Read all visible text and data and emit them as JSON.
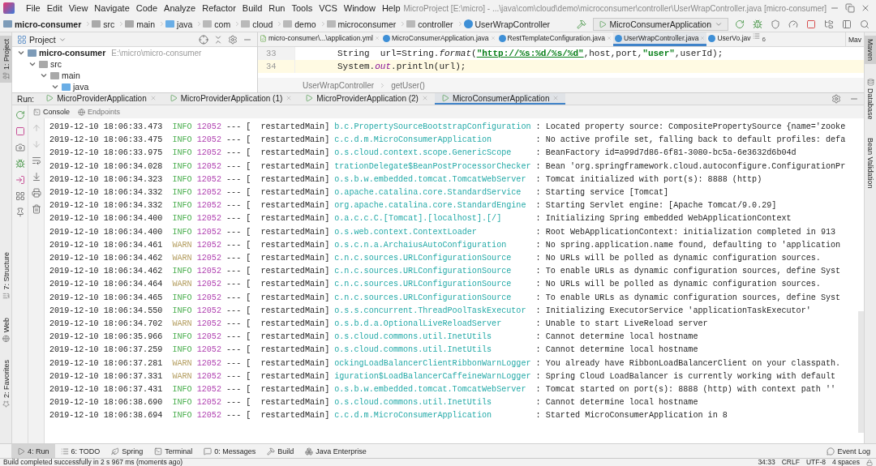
{
  "window": {
    "title": "MicroProject [E:\\micro] - ...\\java\\com\\cloud\\demo\\microconsumer\\controller\\UserWrapController.java [micro-consumer]"
  },
  "menu": [
    "File",
    "Edit",
    "View",
    "Navigate",
    "Code",
    "Analyze",
    "Refactor",
    "Build",
    "Run",
    "Tools",
    "VCS",
    "Window",
    "Help"
  ],
  "breadcrumb": [
    {
      "label": "micro-consumer",
      "kind": "module"
    },
    {
      "label": "src",
      "kind": "folder"
    },
    {
      "label": "main",
      "kind": "folder"
    },
    {
      "label": "java",
      "kind": "source"
    },
    {
      "label": "com",
      "kind": "package"
    },
    {
      "label": "cloud",
      "kind": "package"
    },
    {
      "label": "demo",
      "kind": "package"
    },
    {
      "label": "microconsumer",
      "kind": "package"
    },
    {
      "label": "controller",
      "kind": "package"
    },
    {
      "label": "UserWrapController",
      "kind": "class"
    }
  ],
  "run_config": {
    "label": "MicroConsumerApplication"
  },
  "left_stripe": {
    "top": [
      {
        "label": "1: Project",
        "selected": true
      }
    ],
    "bottom": [
      {
        "label": "7: Structure",
        "selected": false
      },
      {
        "label": "Web",
        "selected": false
      },
      {
        "label": "2: Favorites",
        "selected": false
      }
    ]
  },
  "right_stripe": [
    {
      "label": "Maven",
      "selected": true
    },
    {
      "label": "Database",
      "selected": false
    },
    {
      "label": "Bean Validation",
      "selected": false
    }
  ],
  "project": {
    "title": "Project",
    "tree": [
      {
        "label": "micro-consumer",
        "path": "E:\\micro\\micro-consumer",
        "kind": "module",
        "expanded": true,
        "children": [
          {
            "label": "src",
            "kind": "folder",
            "expanded": true,
            "children": [
              {
                "label": "main",
                "kind": "folder",
                "expanded": true,
                "children": [
                  {
                    "label": "java",
                    "kind": "source",
                    "expanded": true
                  }
                ]
              }
            ]
          }
        ]
      }
    ]
  },
  "editor": {
    "tabs": [
      {
        "label": "micro-consumer\\...\\application.yml",
        "kind": "yaml",
        "selected": false
      },
      {
        "label": "MicroConsumerApplication.java",
        "kind": "class",
        "selected": false
      },
      {
        "label": "RestTemplateConfiguration.java",
        "kind": "class",
        "selected": false
      },
      {
        "label": "UserWrapController.java",
        "kind": "class",
        "selected": true
      },
      {
        "label": "UserVo.jav",
        "kind": "class",
        "selected": false
      }
    ],
    "hidden_tabs": "6",
    "side_panel_label": "Mav",
    "lines": [
      {
        "number": "33",
        "current": false,
        "tokens": [
          {
            "text": "String  url=String.",
            "kind": "plain"
          },
          {
            "text": "format",
            "kind": "static"
          },
          {
            "text": "(",
            "kind": "plain"
          },
          {
            "text": "\"http://%s:%d/%s/%d\"",
            "kind": "url"
          },
          {
            "text": ",host,port,",
            "kind": "plain"
          },
          {
            "text": "\"user\"",
            "kind": "string"
          },
          {
            "text": ",userId);",
            "kind": "plain"
          }
        ]
      },
      {
        "number": "34",
        "current": true,
        "tokens": [
          {
            "text": "System.",
            "kind": "plain"
          },
          {
            "text": "out",
            "kind": "field"
          },
          {
            "text": ".println(url);",
            "kind": "plain"
          }
        ]
      }
    ],
    "breadcrumb": [
      "UserWrapController",
      "getUser()"
    ]
  },
  "run": {
    "label": "Run:",
    "tabs": [
      {
        "label": "MicroProviderApplication",
        "selected": false
      },
      {
        "label": "MicroProviderApplication (1)",
        "selected": false
      },
      {
        "label": "MicroProviderApplication (2)",
        "selected": false
      },
      {
        "label": "MicroConsumerApplication",
        "selected": true
      }
    ],
    "console_tabs": [
      {
        "label": "Console",
        "selected": true
      },
      {
        "label": "Endpoints",
        "selected": false
      }
    ],
    "log": [
      {
        "time": "2019-12-10 18:06:33.473",
        "severity": "INFO",
        "pid": "12052",
        "thread": "--- [  restartedMain]",
        "logger": "b.c.PropertySourceBootstrapConfiguration",
        "message": ": Located property source: CompositePropertySource {name='zooke"
      },
      {
        "time": "2019-12-10 18:06:33.475",
        "severity": "INFO",
        "pid": "12052",
        "thread": "--- [  restartedMain]",
        "logger": "c.c.d.m.MicroConsumerApplication",
        "message": ": No active profile set, falling back to default profiles: defa"
      },
      {
        "time": "2019-12-10 18:06:33.975",
        "severity": "INFO",
        "pid": "12052",
        "thread": "--- [  restartedMain]",
        "logger": "o.s.cloud.context.scope.GenericScope",
        "message": ": BeanFactory id=a99d7d86-6f81-3080-bc5a-6e3632d6b04d"
      },
      {
        "time": "2019-12-10 18:06:34.028",
        "severity": "INFO",
        "pid": "12052",
        "thread": "--- [  restartedMain]",
        "logger": "trationDelegate$BeanPostProcessorChecker",
        "message": ": Bean 'org.springframework.cloud.autoconfigure.ConfigurationPr"
      },
      {
        "time": "2019-12-10 18:06:34.323",
        "severity": "INFO",
        "pid": "12052",
        "thread": "--- [  restartedMain]",
        "logger": "o.s.b.w.embedded.tomcat.TomcatWebServer",
        "message": ": Tomcat initialized with port(s): 8888 (http)"
      },
      {
        "time": "2019-12-10 18:06:34.332",
        "severity": "INFO",
        "pid": "12052",
        "thread": "--- [  restartedMain]",
        "logger": "o.apache.catalina.core.StandardService",
        "message": ": Starting service [Tomcat]"
      },
      {
        "time": "2019-12-10 18:06:34.332",
        "severity": "INFO",
        "pid": "12052",
        "thread": "--- [  restartedMain]",
        "logger": "org.apache.catalina.core.StandardEngine",
        "message": ": Starting Servlet engine: [Apache Tomcat/9.0.29]"
      },
      {
        "time": "2019-12-10 18:06:34.400",
        "severity": "INFO",
        "pid": "12052",
        "thread": "--- [  restartedMain]",
        "logger": "o.a.c.c.C.[Tomcat].[localhost].[/]",
        "message": ": Initializing Spring embedded WebApplicationContext"
      },
      {
        "time": "2019-12-10 18:06:34.400",
        "severity": "INFO",
        "pid": "12052",
        "thread": "--- [  restartedMain]",
        "logger": "o.s.web.context.ContextLoader",
        "message": ": Root WebApplicationContext: initialization completed in 913"
      },
      {
        "time": "2019-12-10 18:06:34.461",
        "severity": "WARN",
        "pid": "12052",
        "thread": "--- [  restartedMain]",
        "logger": "o.s.c.n.a.ArchaiusAutoConfiguration",
        "message": ": No spring.application.name found, defaulting to 'application"
      },
      {
        "time": "2019-12-10 18:06:34.462",
        "severity": "WARN",
        "pid": "12052",
        "thread": "--- [  restartedMain]",
        "logger": "c.n.c.sources.URLConfigurationSource",
        "message": ": No URLs will be polled as dynamic configuration sources."
      },
      {
        "time": "2019-12-10 18:06:34.462",
        "severity": "INFO",
        "pid": "12052",
        "thread": "--- [  restartedMain]",
        "logger": "c.n.c.sources.URLConfigurationSource",
        "message": ": To enable URLs as dynamic configuration sources, define Syst"
      },
      {
        "time": "2019-12-10 18:06:34.464",
        "severity": "WARN",
        "pid": "12052",
        "thread": "--- [  restartedMain]",
        "logger": "c.n.c.sources.URLConfigurationSource",
        "message": ": No URLs will be polled as dynamic configuration sources."
      },
      {
        "time": "2019-12-10 18:06:34.465",
        "severity": "INFO",
        "pid": "12052",
        "thread": "--- [  restartedMain]",
        "logger": "c.n.c.sources.URLConfigurationSource",
        "message": ": To enable URLs as dynamic configuration sources, define Syst"
      },
      {
        "time": "2019-12-10 18:06:34.550",
        "severity": "INFO",
        "pid": "12052",
        "thread": "--- [  restartedMain]",
        "logger": "o.s.s.concurrent.ThreadPoolTaskExecutor",
        "message": ": Initializing ExecutorService 'applicationTaskExecutor'"
      },
      {
        "time": "2019-12-10 18:06:34.702",
        "severity": "WARN",
        "pid": "12052",
        "thread": "--- [  restartedMain]",
        "logger": "o.s.b.d.a.OptionalLiveReloadServer",
        "message": ": Unable to start LiveReload server"
      },
      {
        "time": "2019-12-10 18:06:35.966",
        "severity": "INFO",
        "pid": "12052",
        "thread": "--- [  restartedMain]",
        "logger": "o.s.cloud.commons.util.InetUtils",
        "message": ": Cannot determine local hostname"
      },
      {
        "time": "2019-12-10 18:06:37.259",
        "severity": "INFO",
        "pid": "12052",
        "thread": "--- [  restartedMain]",
        "logger": "o.s.cloud.commons.util.InetUtils",
        "message": ": Cannot determine local hostname"
      },
      {
        "time": "2019-12-10 18:06:37.281",
        "severity": "WARN",
        "pid": "12052",
        "thread": "--- [  restartedMain]",
        "logger": "ockingLoadBalancerClientRibbonWarnLogger",
        "message": ": You already have RibbonLoadBalancerClient on your classpath."
      },
      {
        "time": "2019-12-10 18:06:37.331",
        "severity": "WARN",
        "pid": "12052",
        "thread": "--- [  restartedMain]",
        "logger": "iguration$LoadBalancerCaffeineWarnLogger",
        "message": ": Spring Cloud LoadBalancer is currently working with default"
      },
      {
        "time": "2019-12-10 18:06:37.431",
        "severity": "INFO",
        "pid": "12052",
        "thread": "--- [  restartedMain]",
        "logger": "o.s.b.w.embedded.tomcat.TomcatWebServer",
        "message": ": Tomcat started on port(s): 8888 (http) with context path ''"
      },
      {
        "time": "2019-12-10 18:06:38.690",
        "severity": "INFO",
        "pid": "12052",
        "thread": "--- [  restartedMain]",
        "logger": "o.s.cloud.commons.util.InetUtils",
        "message": ": Cannot determine local hostname"
      },
      {
        "time": "2019-12-10 18:06:38.694",
        "severity": "INFO",
        "pid": "12052",
        "thread": "--- [  restartedMain]",
        "logger": "c.c.d.m.MicroConsumerApplication",
        "message": ": Started MicroConsumerApplication in 8"
      }
    ]
  },
  "tool_tabs": [
    {
      "label": "4: Run",
      "kind": "run",
      "selected": true
    },
    {
      "label": "6: TODO",
      "kind": "todo",
      "selected": false
    },
    {
      "label": "Spring",
      "kind": "spring",
      "selected": false
    },
    {
      "label": "Terminal",
      "kind": "terminal",
      "selected": false
    },
    {
      "label": "0: Messages",
      "kind": "messages",
      "selected": false
    },
    {
      "label": "Build",
      "kind": "build",
      "selected": false
    },
    {
      "label": "Java Enterprise",
      "kind": "enterprise",
      "selected": false
    }
  ],
  "event_log": "Event Log",
  "status_bar": {
    "message": "Build completed successfully in 2 s 967 ms (moments ago)",
    "items": [
      "34:33",
      "CRLF",
      "UTF-8",
      "4 spaces"
    ]
  }
}
